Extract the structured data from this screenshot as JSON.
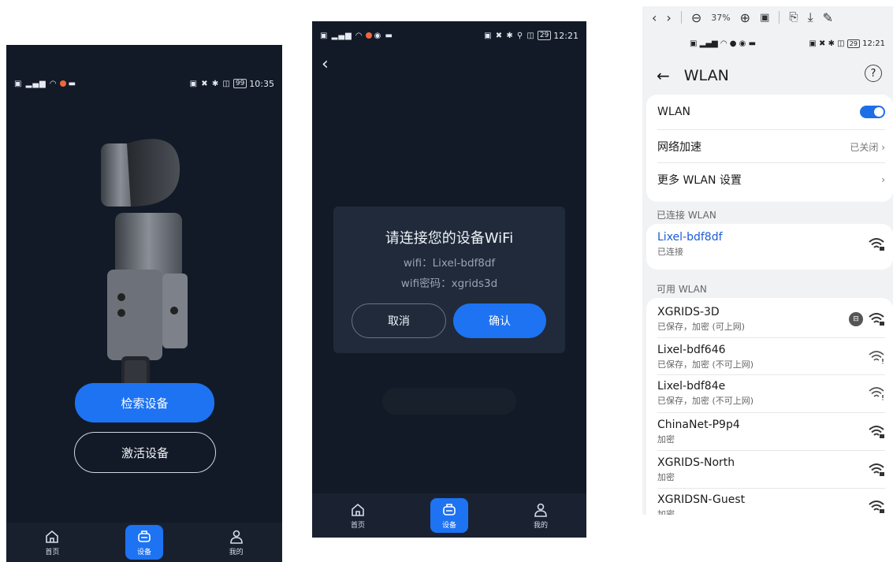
{
  "screen1": {
    "status_time": "10:35",
    "battery": "99",
    "search_button": "检索设备",
    "activate_button": "激活设备",
    "tabs": [
      {
        "label": "首页",
        "icon": "home-icon"
      },
      {
        "label": "设备",
        "icon": "device-icon"
      },
      {
        "label": "我的",
        "icon": "user-icon"
      }
    ]
  },
  "screen2": {
    "status_time": "12:21",
    "battery": "29",
    "dialog": {
      "title": "请连接您的设备WiFi",
      "wifi_line": "wifi：Lixel-bdf8df",
      "password_line": "wifi密码：xgrids3d",
      "cancel": "取消",
      "confirm": "确认"
    },
    "tabs": [
      {
        "label": "首页",
        "icon": "home-icon"
      },
      {
        "label": "设备",
        "icon": "device-icon"
      },
      {
        "label": "我的",
        "icon": "user-icon"
      }
    ]
  },
  "screen3": {
    "viewer_zoom": "37%",
    "status_time": "12:21",
    "battery": "29",
    "title": "WLAN",
    "settings": [
      {
        "label": "WLAN",
        "value": ""
      },
      {
        "label": "网络加速",
        "value": "已关闭"
      },
      {
        "label": "更多 WLAN 设置",
        "value": ""
      }
    ],
    "connected_header": "已连接 WLAN",
    "connected": {
      "name": "Lixel-bdf8df",
      "status": "已连接"
    },
    "available_header": "可用 WLAN",
    "networks": [
      {
        "name": "XGRIDS-3D",
        "status": "已保存，加密 (可上网)"
      },
      {
        "name": "Lixel-bdf646",
        "status": "已保存，加密 (不可上网)"
      },
      {
        "name": "Lixel-bdf84e",
        "status": "已保存，加密 (不可上网)"
      },
      {
        "name": "ChinaNet-P9p4",
        "status": "加密"
      },
      {
        "name": "XGRIDS-North",
        "status": "加密"
      },
      {
        "name": "XGRIDSN-Guest",
        "status": "加密"
      }
    ]
  },
  "colors": {
    "accent": "#1d73f2",
    "dark_bg": "#121a27",
    "dialog_bg": "#202a3a",
    "link_blue": "#1d5bd6"
  }
}
